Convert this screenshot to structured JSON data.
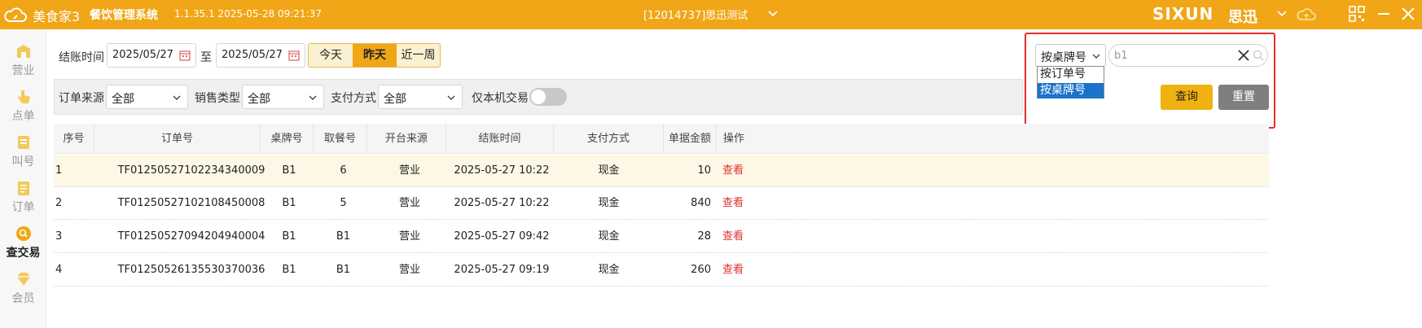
{
  "app": {
    "brand": "美食家3",
    "system_name": "餐饮管理系统",
    "version": "1.1.35.1 2025-05-28 09:21:37",
    "store": "[12014737]思迅测试",
    "vendor": "SIXUN",
    "vendor_cn": "思迅",
    "accent_color": "#f0a616"
  },
  "sidebar": {
    "items": [
      {
        "label": "营业",
        "icon": "store-icon",
        "active": false
      },
      {
        "label": "点单",
        "icon": "hand-pointer-icon",
        "active": false
      },
      {
        "label": "叫号",
        "icon": "calling-icon",
        "active": false
      },
      {
        "label": "订单",
        "icon": "document-icon",
        "active": false
      },
      {
        "label": "查交易",
        "icon": "search-circle-icon",
        "active": true
      },
      {
        "label": "会员",
        "icon": "diamond-icon",
        "active": false
      }
    ]
  },
  "filters": {
    "checkout_time_label": "结账时间",
    "date_from": "2025/05/27",
    "to_label": "至",
    "date_to": "2025/05/27",
    "quick_ranges": [
      {
        "label": "今天",
        "active": false
      },
      {
        "label": "昨天",
        "active": true
      },
      {
        "label": "近一周",
        "active": false
      }
    ],
    "order_source_label": "订单来源",
    "order_source_value": "全部",
    "sales_type_label": "销售类型",
    "sales_type_value": "全部",
    "payment_label": "支付方式",
    "payment_value": "全部",
    "local_only_label": "仅本机交易",
    "local_only_on": false
  },
  "search": {
    "mode_value": "按桌牌号",
    "input_value": "b1",
    "dropdown_options": [
      {
        "label": "按订单号",
        "selected": false
      },
      {
        "label": "按桌牌号",
        "selected": true
      }
    ],
    "query_label": "查询",
    "reset_label": "重置"
  },
  "table": {
    "columns": [
      "序号",
      "订单号",
      "桌牌号",
      "取餐号",
      "开台来源",
      "结账时间",
      "支付方式",
      "单据金额",
      "操作"
    ],
    "rows": [
      {
        "no": "1",
        "order": "TF01250527102234340009",
        "table": "B1",
        "pickup": "6",
        "source": "营业",
        "time": "2025-05-27 10:22",
        "pay": "现金",
        "amount": "10",
        "action": "查看"
      },
      {
        "no": "2",
        "order": "TF01250527102108450008",
        "table": "B1",
        "pickup": "5",
        "source": "营业",
        "time": "2025-05-27 10:22",
        "pay": "现金",
        "amount": "840",
        "action": "查看"
      },
      {
        "no": "3",
        "order": "TF01250527094204940004",
        "table": "B1",
        "pickup": "B1",
        "source": "营业",
        "time": "2025-05-27 09:42",
        "pay": "现金",
        "amount": "28",
        "action": "查看"
      },
      {
        "no": "4",
        "order": "TF01250526135530370036",
        "table": "B1",
        "pickup": "B1",
        "source": "营业",
        "time": "2025-05-27 09:19",
        "pay": "现金",
        "amount": "260",
        "action": "查看"
      }
    ]
  }
}
